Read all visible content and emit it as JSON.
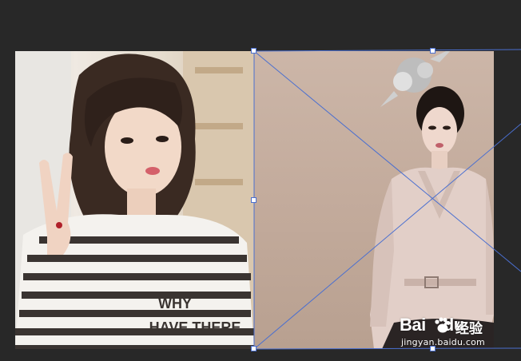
{
  "canvas": {
    "background": "#282828",
    "transform_color": "#4a6fd0"
  },
  "layers": {
    "left_photo": {
      "shirt_text_line1": "WHY",
      "shirt_text_line2": "HAVE THERE"
    },
    "right_photo": {}
  },
  "watermark": {
    "brand": "Bai",
    "brand_suffix": "du",
    "chinese": "经验",
    "url": "jingyan.baidu.com",
    "icon": "baidu-paw-icon"
  }
}
